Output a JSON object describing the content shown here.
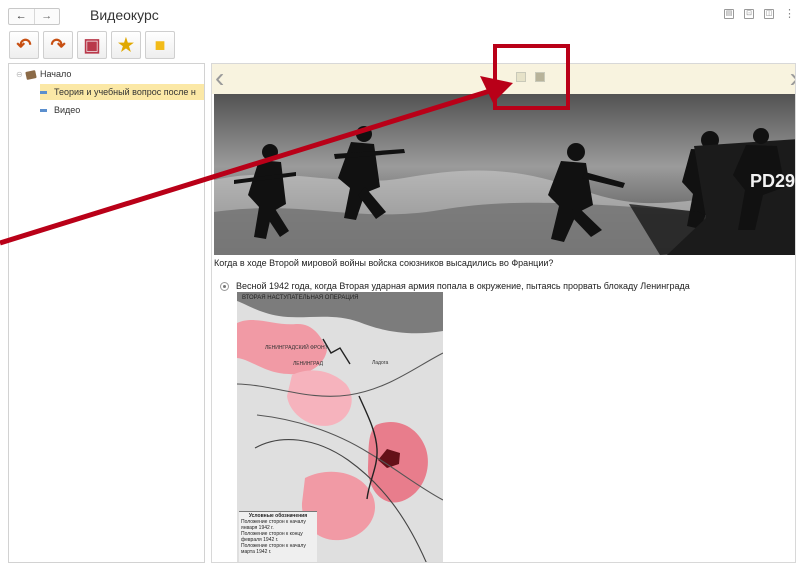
{
  "window": {
    "title": "Видеокурс"
  },
  "nav": {
    "back_icon": "←",
    "forward_icon": "→"
  },
  "top_icons": {
    "save": "▤",
    "print": "⊡",
    "preview": "◫",
    "more": "⋮"
  },
  "toolbar": {
    "items": [
      {
        "icon": "undo-arrow-icon",
        "glyph": "↶",
        "color": "#c74f12"
      },
      {
        "icon": "redo-arrow-icon",
        "glyph": "↷",
        "color": "#c74f12"
      },
      {
        "icon": "book-icon",
        "glyph": "▣",
        "color": "#b9384a"
      },
      {
        "icon": "star-icon",
        "glyph": "★",
        "color": "#e0a800"
      },
      {
        "icon": "note-icon",
        "glyph": "■",
        "color": "#f2bb18"
      }
    ]
  },
  "sidebar": {
    "items": [
      {
        "label": "Начало",
        "level": 0,
        "icon": "book-icon"
      },
      {
        "label": "Теория и учебный вопрос после н",
        "level": 1,
        "selected": true
      },
      {
        "label": "Видео",
        "level": 1
      }
    ]
  },
  "content": {
    "question": "Когда в ходе Второй мировой войны войска союзников высадились во Франции?",
    "answer": "Весной 1942 года, когда Вторая ударная армия попала в окружение, пытаясь прорвать блокаду Ленинграда",
    "banner_text": "PD29",
    "map": {
      "title": "ВТОРАЯ НАСТУПАТЕЛЬНАЯ ОПЕРАЦИЯ",
      "labels": [
        "ЛЕНИНГРАДСКИЙ ФРОНТ",
        "ЛЕНИНГРАД",
        "Ладога"
      ],
      "legend_title": "Условные обозначения",
      "legend_items": [
        "Положение сторон к началу января 1942 г.",
        "Положение сторон к концу февраля 1942 г.",
        "Положение сторон к началу марта 1942 г."
      ]
    }
  },
  "colors": {
    "accent": "#b90018",
    "selected": "#fbe8a6",
    "strip": "#f8f3df"
  }
}
